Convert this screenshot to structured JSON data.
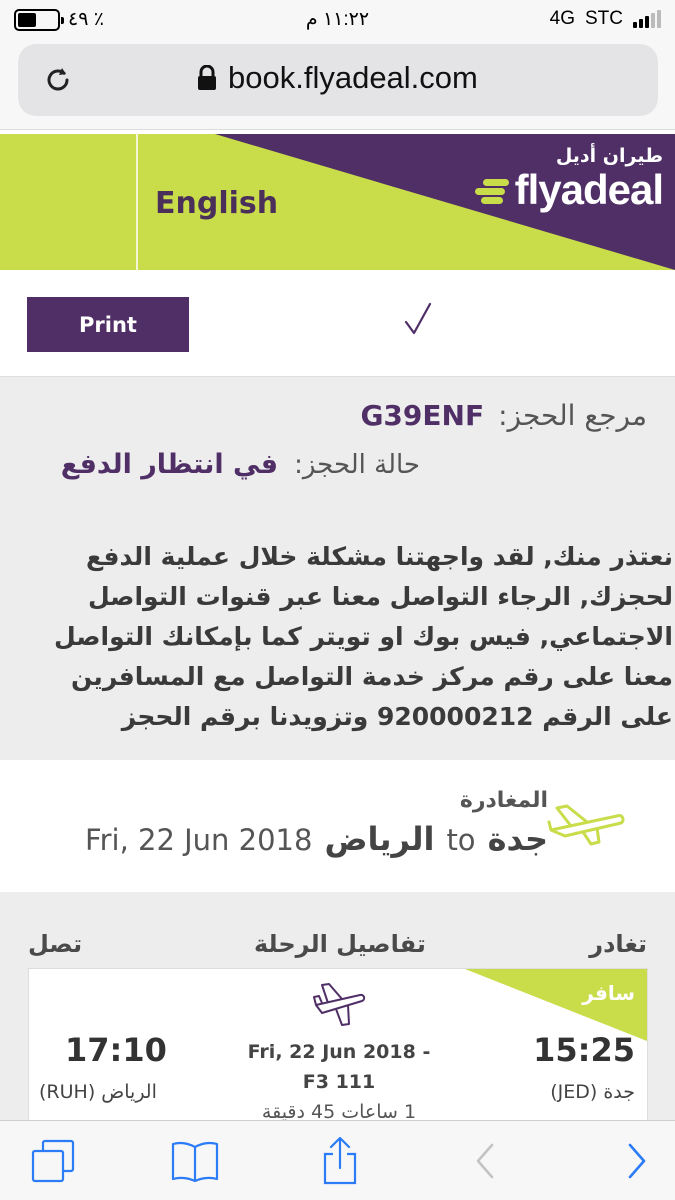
{
  "status_bar": {
    "battery": "٤٩ ٪",
    "time": "١١:٢٢ م",
    "network": "4G",
    "carrier": "STC"
  },
  "browser": {
    "url": "book.flyadeal.com"
  },
  "header": {
    "language_button": "English",
    "logo_arabic": "طيران أديل",
    "logo_text": "flyadeal",
    "brand_purple": "#4f2f66",
    "brand_lime": "#c9dc4a"
  },
  "actions": {
    "print_label": "Print"
  },
  "booking": {
    "ref_label": "مرجع الحجز:",
    "ref_value": "G39ENF",
    "status_label": "حالة الحجز:",
    "status_value": "في انتظار الدفع",
    "message": "نعتذر منك, لقد واجهتنا مشكلة خلال عملية الدفع لحجزك, الرجاء التواصل معنا عبر قنوات التواصل الاجتماعي, فيس بوك او تويتر كما بإمكانك التواصل معنا على رقم مركز خدمة التواصل مع المسافرين على الرقم 920000212 وتزويدنا برقم الحجز"
  },
  "departure": {
    "title": "المغادرة",
    "from": "الرياض",
    "to_word": "to",
    "to": "جدة",
    "date": "Fri, 22 Jun 2018"
  },
  "flight": {
    "headers": {
      "depart": "تغادر",
      "details": "تفاصيل الرحلة",
      "arrive": "تصل"
    },
    "badge": "سافر",
    "depart_time": "15:25",
    "depart_city": "جدة (JED)",
    "arrive_time": "17:10",
    "arrive_city": "الرياض (RUH)",
    "date": "Fri, 22 Jun 2018 -",
    "flight_no": "F3 111",
    "duration": "1 ساعات 45 دقيقة"
  }
}
